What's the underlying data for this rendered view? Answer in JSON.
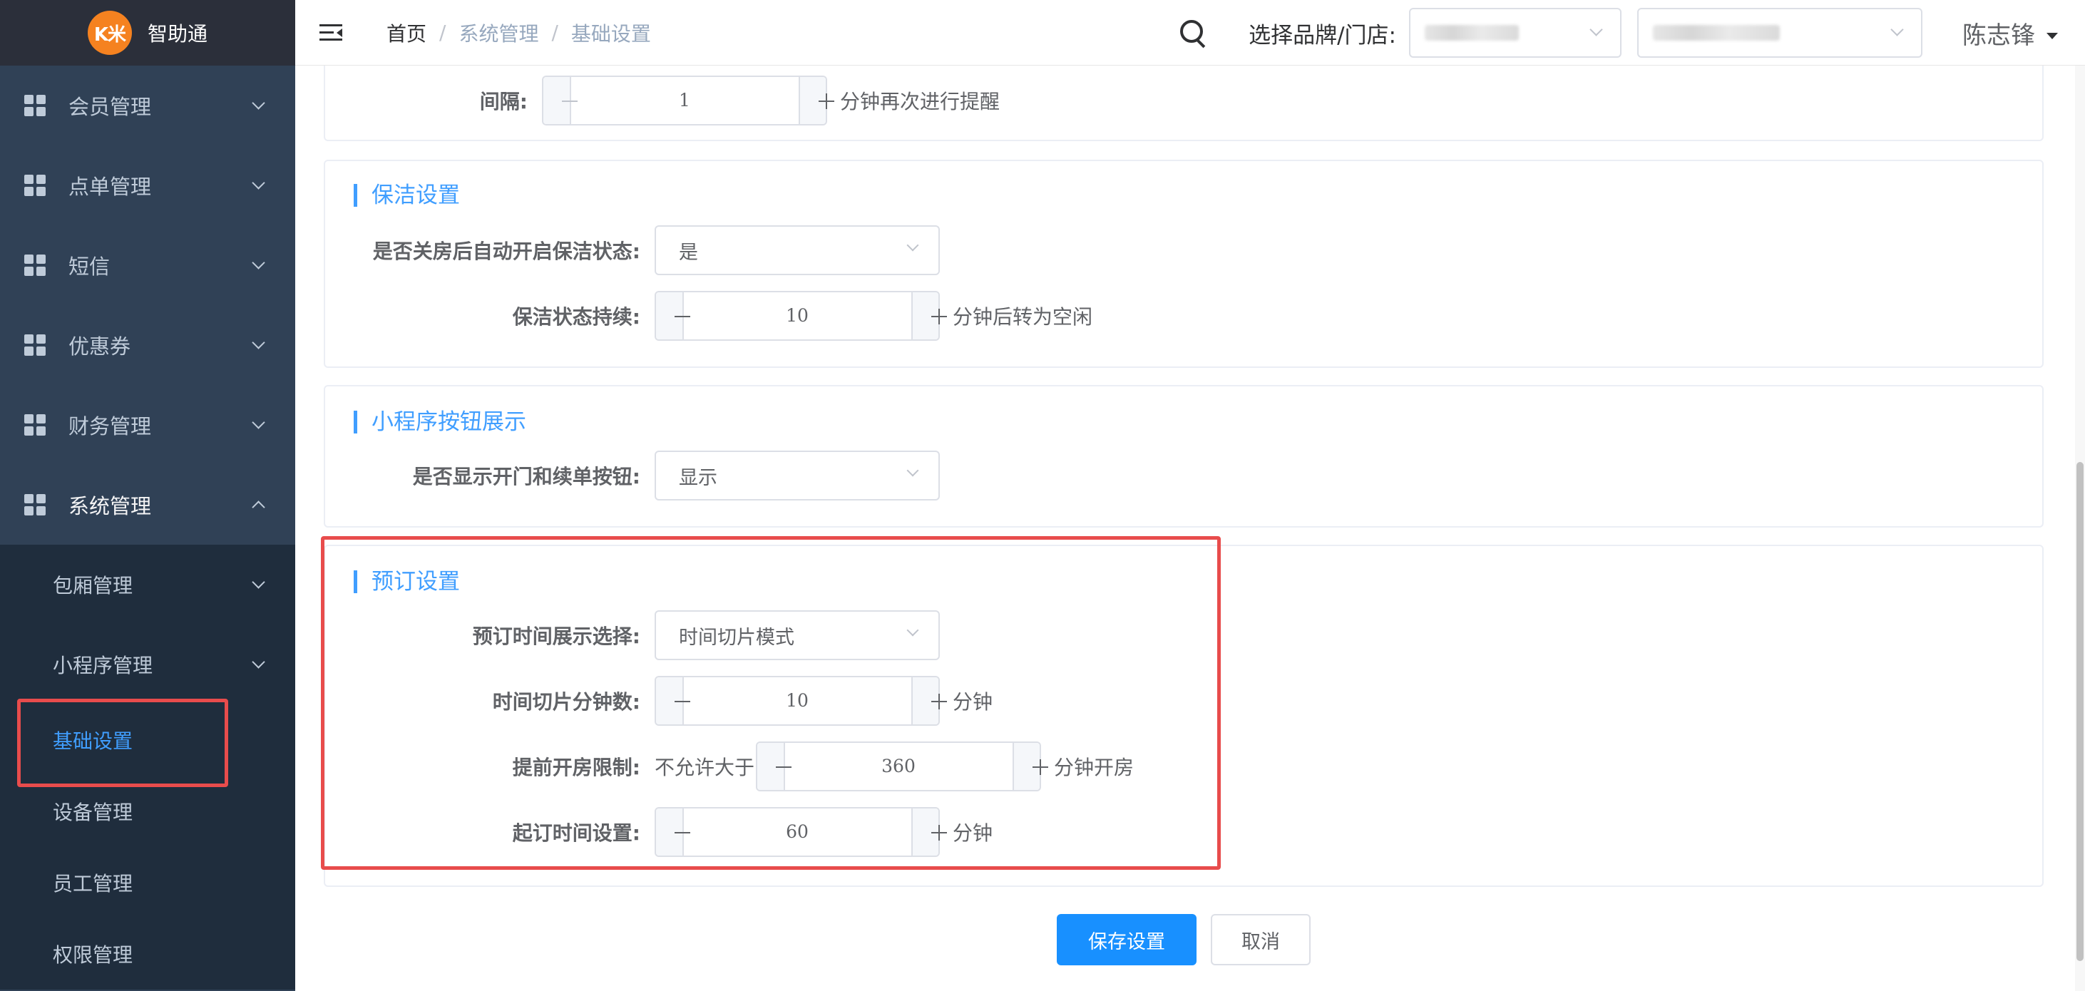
{
  "app": {
    "logo_text": "K米",
    "title": "智助通"
  },
  "sidebar": {
    "items": [
      {
        "label": "会员管理"
      },
      {
        "label": "点单管理"
      },
      {
        "label": "短信"
      },
      {
        "label": "优惠券"
      },
      {
        "label": "财务管理"
      },
      {
        "label": "系统管理"
      }
    ],
    "sub_items": [
      {
        "label": "包厢管理"
      },
      {
        "label": "小程序管理"
      },
      {
        "label": "基础设置"
      },
      {
        "label": "设备管理"
      },
      {
        "label": "员工管理"
      },
      {
        "label": "权限管理"
      }
    ]
  },
  "header": {
    "breadcrumb": [
      "首页",
      "系统管理",
      "基础设置"
    ],
    "separator": "/",
    "brand_label": "选择品牌/门店:",
    "user_name": "陈志锋"
  },
  "reminder": {
    "label": "间隔:",
    "value": "1",
    "suffix": "分钟再次进行提醒"
  },
  "cleaning": {
    "title": "保洁设置",
    "auto_label": "是否关房后自动开启保洁状态:",
    "auto_value": "是",
    "duration_label": "保洁状态持续:",
    "duration_value": "10",
    "duration_suffix": "分钟后转为空闲"
  },
  "miniapp": {
    "title": "小程序按钮展示",
    "show_label": "是否显示开门和续单按钮:",
    "show_value": "显示"
  },
  "booking": {
    "title": "预订设置",
    "display_label": "预订时间展示选择:",
    "display_value": "时间切片模式",
    "slice_label": "时间切片分钟数:",
    "slice_value": "10",
    "slice_suffix": "分钟",
    "advance_label": "提前开房限制:",
    "advance_prefix": "不允许大于",
    "advance_value": "360",
    "advance_suffix": "分钟开房",
    "min_label": "起订时间设置:",
    "min_value": "60",
    "min_suffix": "分钟"
  },
  "actions": {
    "save": "保存设置",
    "cancel": "取消"
  },
  "colors": {
    "accent": "#409eff",
    "primary_button": "#1890ff",
    "highlight": "#e84c4c",
    "sidebar": "#304156"
  }
}
